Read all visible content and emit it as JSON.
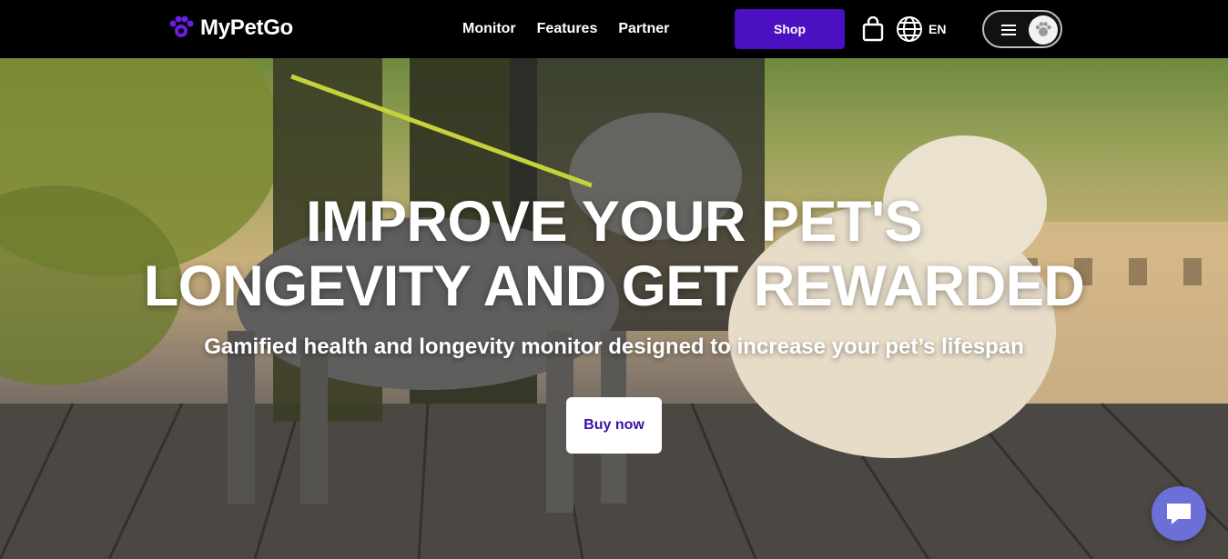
{
  "header": {
    "logo_text": "MyPetGo",
    "nav": [
      {
        "label": "Monitor"
      },
      {
        "label": "Features"
      },
      {
        "label": "Partner"
      }
    ],
    "shop_label": "Shop",
    "language": "EN"
  },
  "hero": {
    "title_line1": "IMPROVE YOUR PET'S",
    "title_line2": "LONGEVITY AND GET REWARDED",
    "subtitle": "Gamified health and longevity monitor designed to increase your pet’s lifespan",
    "cta_label": "Buy now"
  },
  "colors": {
    "brand_purple": "#4a10c2",
    "cta_text": "#3b10a8",
    "chat_bubble": "#6c6fd8",
    "header_bg": "#000000"
  },
  "icons": [
    "paw-logo-icon",
    "shopping-bag-icon",
    "globe-icon",
    "hamburger-menu-icon",
    "paw-avatar-icon",
    "chat-icon"
  ]
}
